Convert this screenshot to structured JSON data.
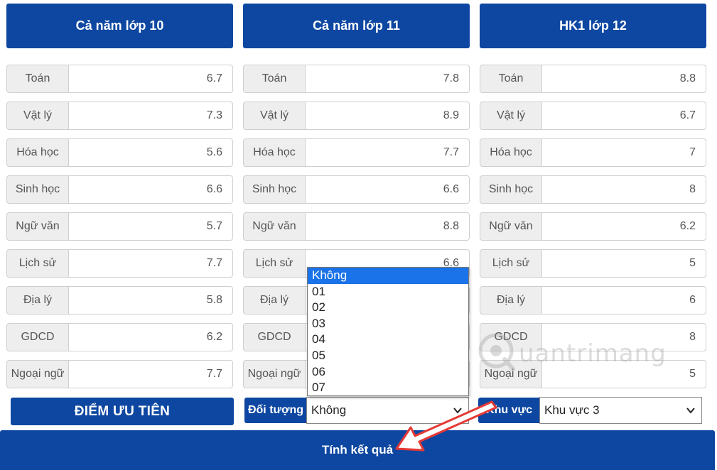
{
  "columns": [
    {
      "title": "Cả năm lớp 10",
      "rows": [
        {
          "label": "Toán",
          "value": "6.7"
        },
        {
          "label": "Vật lý",
          "value": "7.3"
        },
        {
          "label": "Hóa học",
          "value": "5.6"
        },
        {
          "label": "Sinh học",
          "value": "6.6"
        },
        {
          "label": "Ngữ văn",
          "value": "5.7"
        },
        {
          "label": "Lịch sử",
          "value": "7.7"
        },
        {
          "label": "Địa lý",
          "value": "5.8"
        },
        {
          "label": "GDCD",
          "value": "6.2"
        },
        {
          "label": "Ngoại ngữ",
          "value": "7.7"
        }
      ]
    },
    {
      "title": "Cả năm lớp 11",
      "rows": [
        {
          "label": "Toán",
          "value": "7.8"
        },
        {
          "label": "Vật lý",
          "value": "8.9"
        },
        {
          "label": "Hóa học",
          "value": "7.7"
        },
        {
          "label": "Sinh học",
          "value": "6.6"
        },
        {
          "label": "Ngữ văn",
          "value": "8.8"
        },
        {
          "label": "Lịch sử",
          "value": "6.6"
        },
        {
          "label": "Địa lý",
          "value": ""
        },
        {
          "label": "GDCD",
          "value": ""
        },
        {
          "label": "Ngoại ngữ",
          "value": ""
        }
      ]
    },
    {
      "title": "HK1 lớp 12",
      "rows": [
        {
          "label": "Toán",
          "value": "8.8"
        },
        {
          "label": "Vật lý",
          "value": "6.7"
        },
        {
          "label": "Hóa học",
          "value": "7"
        },
        {
          "label": "Sinh học",
          "value": "8"
        },
        {
          "label": "Ngữ văn",
          "value": "6.2"
        },
        {
          "label": "Lịch sử",
          "value": "5"
        },
        {
          "label": "Địa lý",
          "value": "6"
        },
        {
          "label": "GDCD",
          "value": "8"
        },
        {
          "label": "Ngoại ngữ",
          "value": "5"
        }
      ]
    }
  ],
  "priority_button": "ĐIỂM ƯU TIÊN",
  "doi_tuong": {
    "label": "Đối tượng",
    "selected": "Không",
    "options": [
      "Không",
      "01",
      "02",
      "03",
      "04",
      "05",
      "06",
      "07"
    ]
  },
  "khu_vuc": {
    "label": "Khu vực",
    "selected": "Khu vực 3"
  },
  "result_button": "Tính kết quả",
  "watermark": "uantrimang",
  "icons": {
    "select": "chevron-down-icon",
    "annotation": "red-arrow-icon",
    "logo": "quantrimang-logo-icon"
  },
  "colors": {
    "primary": "#0d47a1",
    "selected_option": "#1a73e8",
    "arrow": "#e53935"
  }
}
